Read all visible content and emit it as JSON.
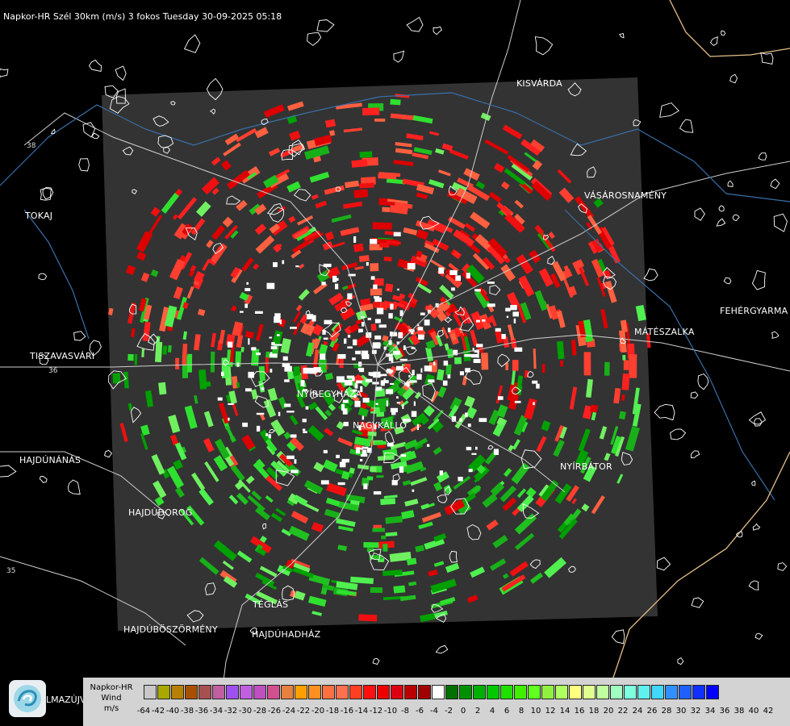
{
  "header": {
    "title": "Napkor-HR Szél 30km (m/s) 3 fokos Tuesday 30-09-2025 05:18"
  },
  "map": {
    "towns": [
      {
        "id": "kisvarda",
        "label": "KISVÁRDA"
      },
      {
        "id": "vasarosnameny",
        "label": "VÁSÁROSNAMÉNY"
      },
      {
        "id": "tokaj",
        "label": "TOKAJ"
      },
      {
        "id": "fehergyarmat",
        "label": "FEHÉRGYARMA"
      },
      {
        "id": "mateszalka",
        "label": "MÁTÉSZALKA"
      },
      {
        "id": "tiszavasvari",
        "label": "TISZAVASVÁRI"
      },
      {
        "id": "nyiregyhaza",
        "label": "NYÍREGYHÁZA"
      },
      {
        "id": "nagykallo",
        "label": "NAGYKÁLLÓ"
      },
      {
        "id": "hajdunanas",
        "label": "HAJDÚNÁNÁS"
      },
      {
        "id": "nyirbator",
        "label": "NYÍRBÁTOR"
      },
      {
        "id": "hajdudorog",
        "label": "HAJDÚDOROG"
      },
      {
        "id": "teglas",
        "label": "TÉGLÁS"
      },
      {
        "id": "hajduboszormeny",
        "label": "HAJDÚBÖSZÖRMÉNY"
      },
      {
        "id": "hajduhadhaz",
        "label": "HAJDÚHADHÁZ"
      }
    ],
    "road_numbers": [
      "38",
      "36",
      "35"
    ],
    "watermark_text": "LMAZÚJVÁR"
  },
  "legend": {
    "title_lines": [
      "Napkor-HR",
      "Wind",
      "m/s"
    ],
    "colors": [
      "#c8c8c8",
      "#a8a800",
      "#b88000",
      "#a85000",
      "#a85050",
      "#c060a0",
      "#a050f0",
      "#c060e0",
      "#c050c0",
      "#d05090",
      "#e88040",
      "#ffa000",
      "#ff9020",
      "#ff7040",
      "#ff7050",
      "#ff4020",
      "#ff1010",
      "#ee0000",
      "#dd0010",
      "#bb0000",
      "#a00000",
      "#ffffff",
      "#007000",
      "#009000",
      "#00b000",
      "#00c800",
      "#20e000",
      "#40f000",
      "#60ff20",
      "#90f040",
      "#b0ff60",
      "#ffff80",
      "#e0ff90",
      "#c0ffa0",
      "#a0ffc0",
      "#80ffe0",
      "#60f0f0",
      "#40d8ff",
      "#3090ff",
      "#2060ff",
      "#1030ff",
      "#0000ff"
    ],
    "tick_labels": [
      "-64",
      "-42",
      "-40",
      "-38",
      "-36",
      "-34",
      "-32",
      "-30",
      "-28",
      "-26",
      "-24",
      "-22",
      "-20",
      "-18",
      "-16",
      "-14",
      "-12",
      "-10",
      "-8",
      "-6",
      "-4",
      "-2",
      "0",
      "2",
      "4",
      "6",
      "8",
      "10",
      "12",
      "14",
      "16",
      "18",
      "20",
      "22",
      "24",
      "26",
      "28",
      "30",
      "32",
      "34",
      "36",
      "38",
      "40",
      "42"
    ]
  }
}
